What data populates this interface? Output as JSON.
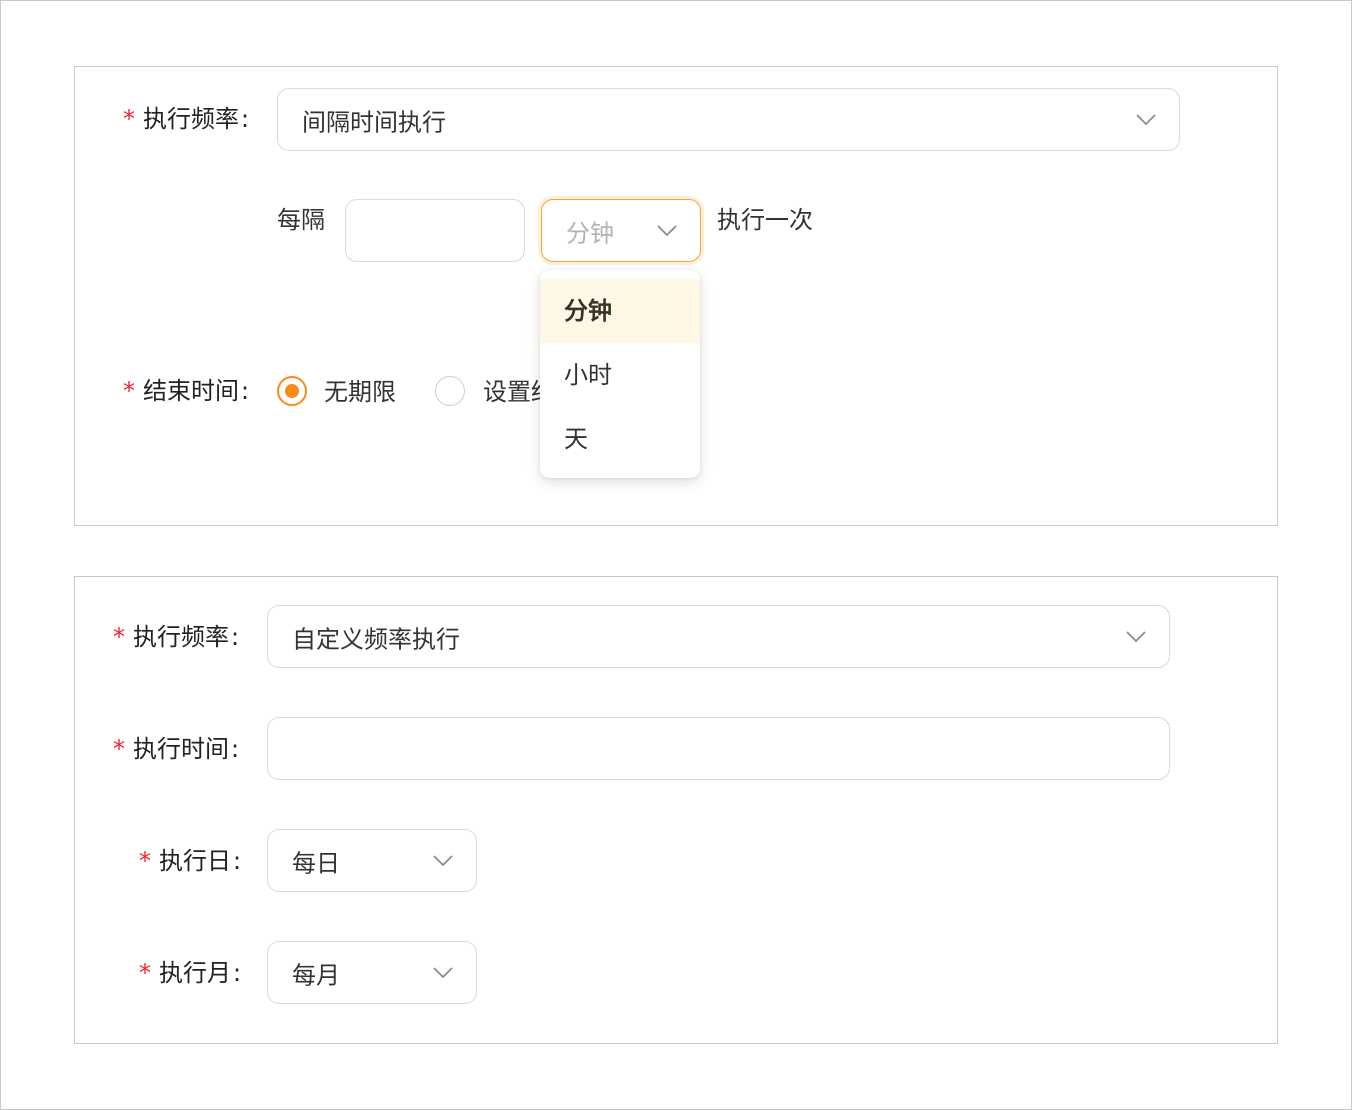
{
  "colors": {
    "accent": "#fa8c16",
    "required": "#f5222d",
    "selected_option_bg": "#fff7e6",
    "border": "#d9d9d9"
  },
  "panel1": {
    "frequency": {
      "required_mark": "*",
      "label": "执行频率",
      "colon": ":",
      "value": "间隔时间执行"
    },
    "interval": {
      "prefix": "每隔",
      "number_value": "",
      "unit_select_value": "分钟",
      "suffix": "执行一次"
    },
    "end_time": {
      "required_mark": "*",
      "label": "结束时间",
      "colon": ":",
      "options": [
        {
          "label": "无期限",
          "checked": true
        },
        {
          "label": "设置结",
          "checked": false
        }
      ]
    },
    "unit_dropdown": {
      "options": [
        "分钟",
        "小时",
        "天"
      ],
      "selected": "分钟"
    }
  },
  "panel2": {
    "frequency": {
      "required_mark": "*",
      "label": "执行频率",
      "colon": ":",
      "value": "自定义频率执行"
    },
    "exec_time": {
      "required_mark": "*",
      "label": "执行时间",
      "colon": ":",
      "value": ""
    },
    "exec_day": {
      "required_mark": "*",
      "label": "执行日",
      "colon": ":",
      "value": "每日"
    },
    "exec_month": {
      "required_mark": "*",
      "label": "执行月",
      "colon": ":",
      "value": "每月"
    }
  }
}
